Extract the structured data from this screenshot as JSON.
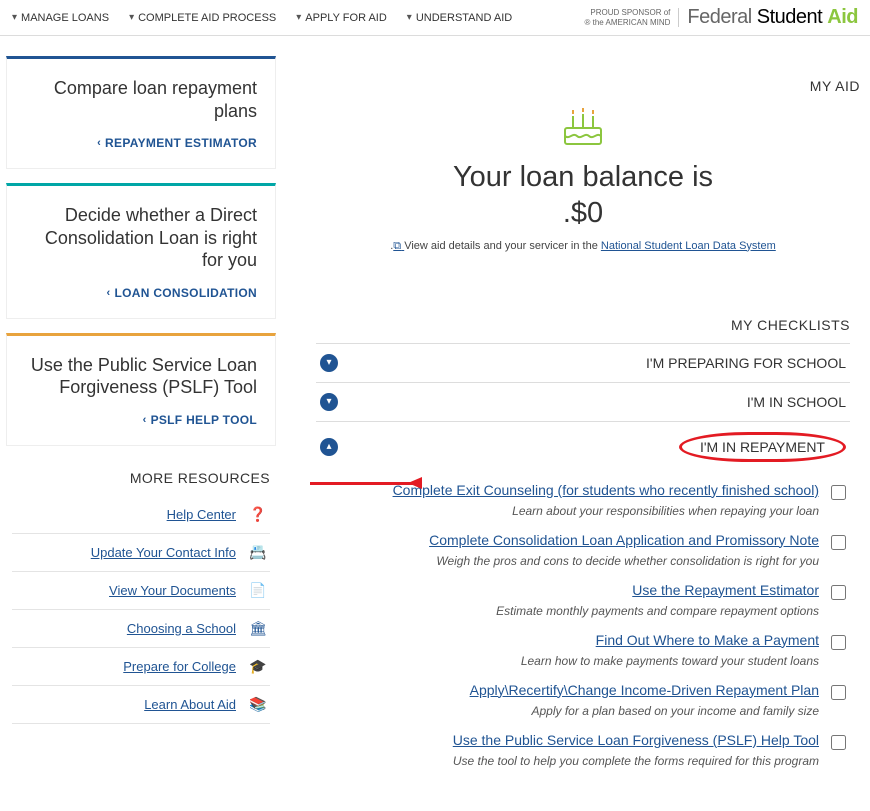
{
  "header": {
    "logo_grey": "Federal ",
    "logo_dark": "Student",
    "logo_green": "Aid",
    "sponsor_line1": "PROUD SPONSOR of",
    "sponsor_line2": "the AMERICAN MIND ®",
    "nav": [
      "UNDERSTAND AID",
      "APPLY FOR AID",
      "COMPLETE AID PROCESS",
      "MANAGE LOANS"
    ]
  },
  "aid": {
    "title": "MY AID",
    "balance_line1": "Your loan balance is",
    "balance_line2": "$0.",
    "detail_prefix": "View aid details and your servicer in the ",
    "detail_link": "National Student Loan Data System",
    "detail_suffix": "."
  },
  "check": {
    "title": "MY CHECKLISTS",
    "rows": [
      "I'M PREPARING FOR SCHOOL",
      "I'M IN SCHOOL",
      "I'M IN REPAYMENT"
    ],
    "items": [
      {
        "link": "Complete Exit Counseling (for students who recently finished school)",
        "desc": "Learn about your responsibilities when repaying your loan"
      },
      {
        "link": "Complete Consolidation Loan Application and Promissory Note",
        "desc": "Weigh the pros and cons to decide whether consolidation is right for you"
      },
      {
        "link": "Use the Repayment Estimator",
        "desc": "Estimate monthly payments and compare repayment options"
      },
      {
        "link": "Find Out Where to Make a Payment",
        "desc": "Learn how to make payments toward your student loans"
      },
      {
        "link": "Apply\\Recertify\\Change Income-Driven Repayment Plan",
        "desc": "Apply for a plan based on your income and family size"
      },
      {
        "link": "Use the Public Service Loan Forgiveness (PSLF) Help Tool",
        "desc": "Use the tool to help you complete the forms required for this program"
      }
    ]
  },
  "side": {
    "cards": [
      {
        "title": "Compare loan repayment plans",
        "link": "REPAYMENT ESTIMATOR"
      },
      {
        "title": "Decide whether a Direct Consolidation Loan is right for you",
        "link": "LOAN CONSOLIDATION"
      },
      {
        "title": "Use the Public Service Loan Forgiveness (PSLF) Tool",
        "link": "PSLF HELP TOOL"
      }
    ],
    "res_title": "MORE RESOURCES",
    "res": [
      {
        "icon": "❓",
        "label": "Help Center"
      },
      {
        "icon": "📇",
        "label": "Update Your Contact Info"
      },
      {
        "icon": "📄",
        "label": "View Your Documents"
      },
      {
        "icon": "🏛",
        "label": "Choosing a School"
      },
      {
        "icon": "🎓",
        "label": "Prepare for College"
      },
      {
        "icon": "📚",
        "label": "Learn About Aid"
      }
    ]
  }
}
